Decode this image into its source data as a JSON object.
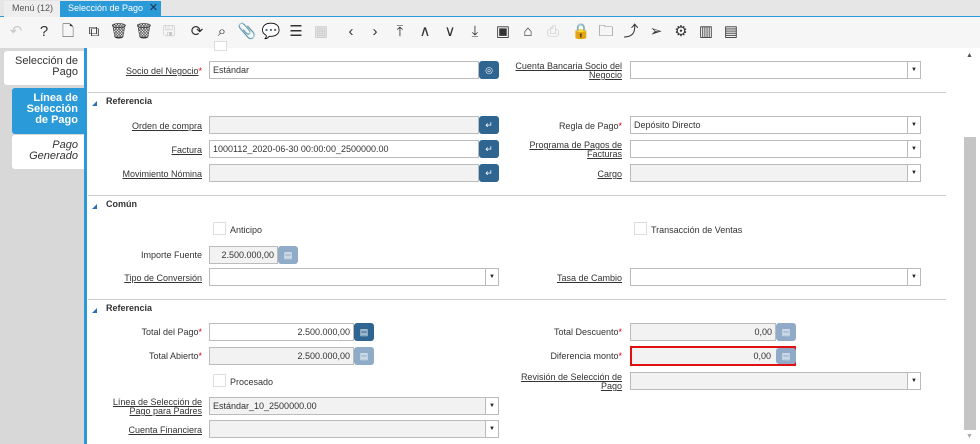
{
  "tabs": {
    "menu": "Menú (12)",
    "active": "Selección de Pago",
    "close": "✕"
  },
  "toolbar": [
    {
      "name": "undo-icon",
      "g": "↶",
      "dis": true
    },
    {
      "name": "help-icon",
      "g": "?"
    },
    {
      "name": "new-record-icon",
      "g": "🗋"
    },
    {
      "name": "copy-record-icon",
      "g": "⧉"
    },
    {
      "name": "delete-icon",
      "g": "🗑"
    },
    {
      "name": "delete-selection-icon",
      "g": "🗑"
    },
    {
      "name": "save-icon",
      "g": "🖫",
      "dis": true
    },
    {
      "name": "refresh-icon",
      "g": "⟳"
    },
    {
      "name": "find-icon",
      "g": "⌕"
    },
    {
      "name": "attachment-icon",
      "g": "📎"
    },
    {
      "name": "chat-icon",
      "g": "💬"
    },
    {
      "name": "grid-toggle-icon",
      "g": "☰"
    },
    {
      "name": "calendar-icon",
      "g": "▦",
      "dis": true
    },
    {
      "name": "previous-icon",
      "g": "‹"
    },
    {
      "name": "next-icon",
      "g": "›"
    },
    {
      "name": "first-record-icon",
      "g": "⤒"
    },
    {
      "name": "parent-record-icon",
      "g": "∧"
    },
    {
      "name": "detail-record-icon",
      "g": "∨"
    },
    {
      "name": "last-record-icon",
      "g": "⤓"
    },
    {
      "name": "report-icon",
      "g": "▣"
    },
    {
      "name": "archive-icon",
      "g": "⌂"
    },
    {
      "name": "print-icon",
      "g": "⎙",
      "dis": true
    },
    {
      "name": "lock-icon",
      "g": "🔒"
    },
    {
      "name": "zoom-across-icon",
      "g": "🗀"
    },
    {
      "name": "workflow-icon",
      "g": "⤴"
    },
    {
      "name": "send-icon",
      "g": "➢"
    },
    {
      "name": "process-icon",
      "g": "⚙"
    },
    {
      "name": "product-info-icon",
      "g": "▥"
    },
    {
      "name": "customize-icon",
      "g": "▤"
    }
  ],
  "left_tabs": [
    "Selección de Pago",
    "Línea de Selección de Pago",
    "Pago Generado"
  ],
  "header": {
    "socio_label": "Socio del Negocio",
    "socio_value": "Estándar",
    "cuenta_bancaria_label": "Cuenta Bancaria Socio del Negocio",
    "cuenta_bancaria_value": ""
  },
  "referencia1": {
    "title": "Referencia",
    "orden_label": "Orden de compra",
    "orden_value": "",
    "factura_label": "Factura",
    "factura_value": "1000112_2020-06-30 00:00:00_2500000.00",
    "movimiento_label": "Movimiento Nómina",
    "movimiento_value": "",
    "regla_label": "Regla de Pago",
    "regla_value": "Depósito Directo",
    "programa_label": "Programa de Pagos de Facturas",
    "programa_value": "",
    "cargo_label": "Cargo",
    "cargo_value": ""
  },
  "comun": {
    "title": "Común",
    "anticipo_label": "Anticipo",
    "transaccion_label": "Transacción de Ventas",
    "importe_label": "Importe Fuente",
    "importe_value": "2.500.000,00",
    "tipo_label": "Tipo de Conversión",
    "tipo_value": "",
    "tasa_label": "Tasa de Cambio",
    "tasa_value": ""
  },
  "referencia2": {
    "title": "Referencia",
    "total_pago_label": "Total del Pago",
    "total_pago_value": "2.500.000,00",
    "total_abierto_label": "Total Abierto",
    "total_abierto_value": "2.500.000,00",
    "procesado_label": "Procesado",
    "linea_label": "Línea de Selección de Pago para Padres",
    "linea_value": "Estándar_10_2500000.00",
    "cuenta_fin_label": "Cuenta Financiera",
    "cuenta_fin_value": "",
    "total_desc_label": "Total Descuento",
    "total_desc_value": "0,00",
    "diferencia_label": "Diferencia monto",
    "diferencia_value": "0,00",
    "revision_label": "Revisión de Selección de Pago",
    "revision_value": ""
  },
  "required_mark": "*",
  "colors": {
    "accent": "#2a9ad8",
    "button": "#2f6591",
    "error": "#e01010"
  }
}
